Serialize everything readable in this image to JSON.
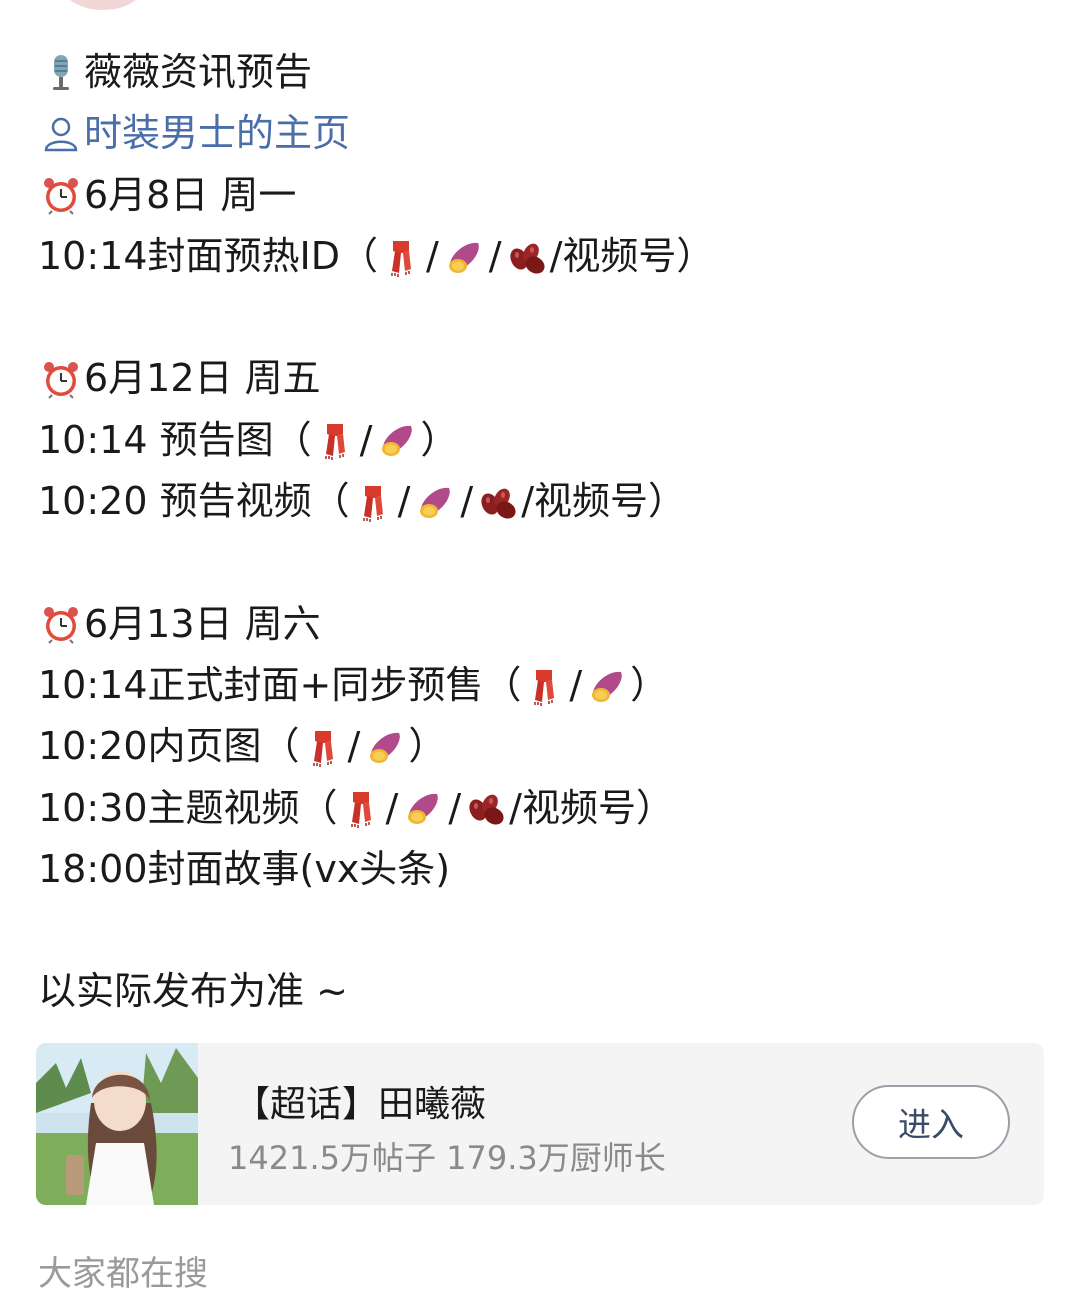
{
  "post": {
    "heading": "薇薇资讯预告",
    "profile_link": "时装男士的主页",
    "blocks": [
      {
        "date": "6月8日 周一",
        "items": [
          {
            "time": "10:14封面预热ID（",
            "platforms": [
              "scarf",
              "sweet-potato",
              "beans"
            ],
            "tail": "/视频号）"
          }
        ]
      },
      {
        "date": "6月12日 周五",
        "items": [
          {
            "time": "10:14 预告图（",
            "platforms": [
              "scarf",
              "sweet-potato"
            ],
            "tail": "）"
          },
          {
            "time": "10:20 预告视频（",
            "platforms": [
              "scarf",
              "sweet-potato",
              "beans"
            ],
            "tail": "/视频号）"
          }
        ]
      },
      {
        "date": "6月13日 周六",
        "items": [
          {
            "time": "10:14正式封面+同步预售（",
            "platforms": [
              "scarf",
              "sweet-potato"
            ],
            "tail": "）"
          },
          {
            "time": "10:20内页图（",
            "platforms": [
              "scarf",
              "sweet-potato"
            ],
            "tail": "）"
          },
          {
            "time": "10:30主题视频（",
            "platforms": [
              "scarf",
              "sweet-potato",
              "beans"
            ],
            "tail": "/视频号）"
          },
          {
            "time": "18:00封面故事(vx头条)",
            "platforms": [],
            "tail": ""
          }
        ]
      }
    ],
    "footer_note": "以实际发布为准 ~"
  },
  "super_topic_card": {
    "title": "【超话】田曦薇",
    "stats": "1421.5万帖子 179.3万厨师长",
    "enter_label": "进入"
  },
  "bottom_section_label": "大家都在搜",
  "icons": {
    "heading": "microphone-icon",
    "profile": "person-icon",
    "date": "alarm-clock-icon",
    "platform_a": "scarf-icon",
    "platform_b": "sweet-potato-icon",
    "platform_c": "beans-icon"
  },
  "colors": {
    "link": "#4a6ea9",
    "text": "#1a1a1a",
    "muted": "#8a8a8a",
    "card_bg": "#f4f4f4"
  }
}
